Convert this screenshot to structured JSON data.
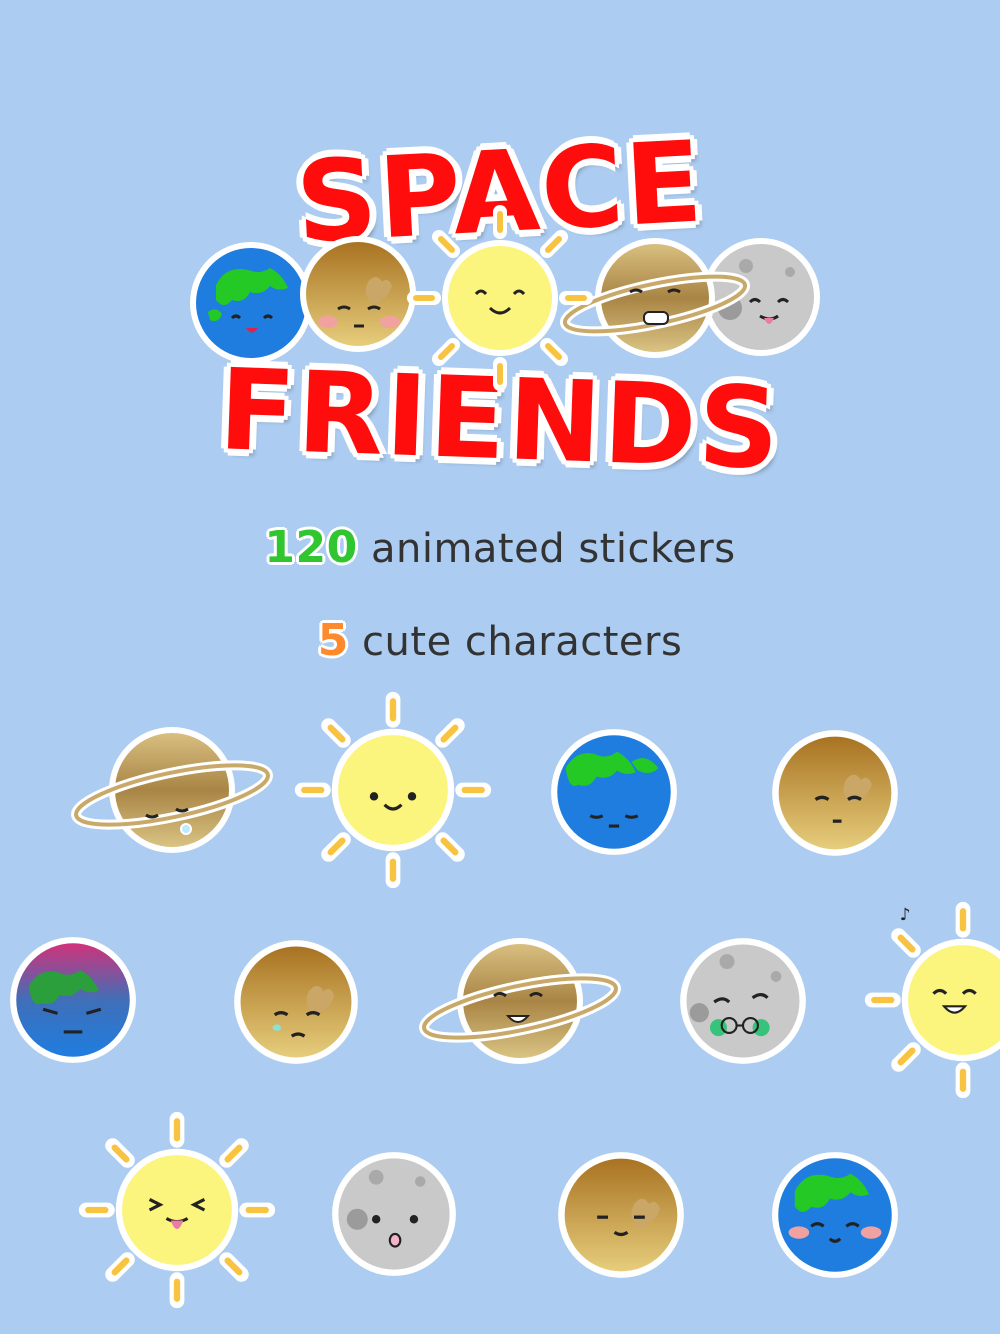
{
  "title": {
    "line1": "SPACE",
    "line2": "FRIENDS"
  },
  "taglines": [
    {
      "number": "120",
      "text": " animated stickers"
    },
    {
      "number": "5",
      "text": " cute characters"
    }
  ],
  "colors": {
    "background": "#acccf1",
    "title": "#ff0d0d",
    "number_green": "#2fc62f",
    "number_orange": "#ff8a2b"
  },
  "stickers": [
    "earth-icon",
    "mars-icon",
    "sun-icon",
    "saturn-icon",
    "moon-icon",
    "saturn-icon",
    "sun-icon",
    "earth-icon",
    "mars-icon",
    "earth-icon",
    "mars-icon",
    "saturn-icon",
    "moon-icon",
    "sun-icon",
    "sun-icon",
    "moon-icon",
    "mars-icon",
    "earth-icon"
  ]
}
